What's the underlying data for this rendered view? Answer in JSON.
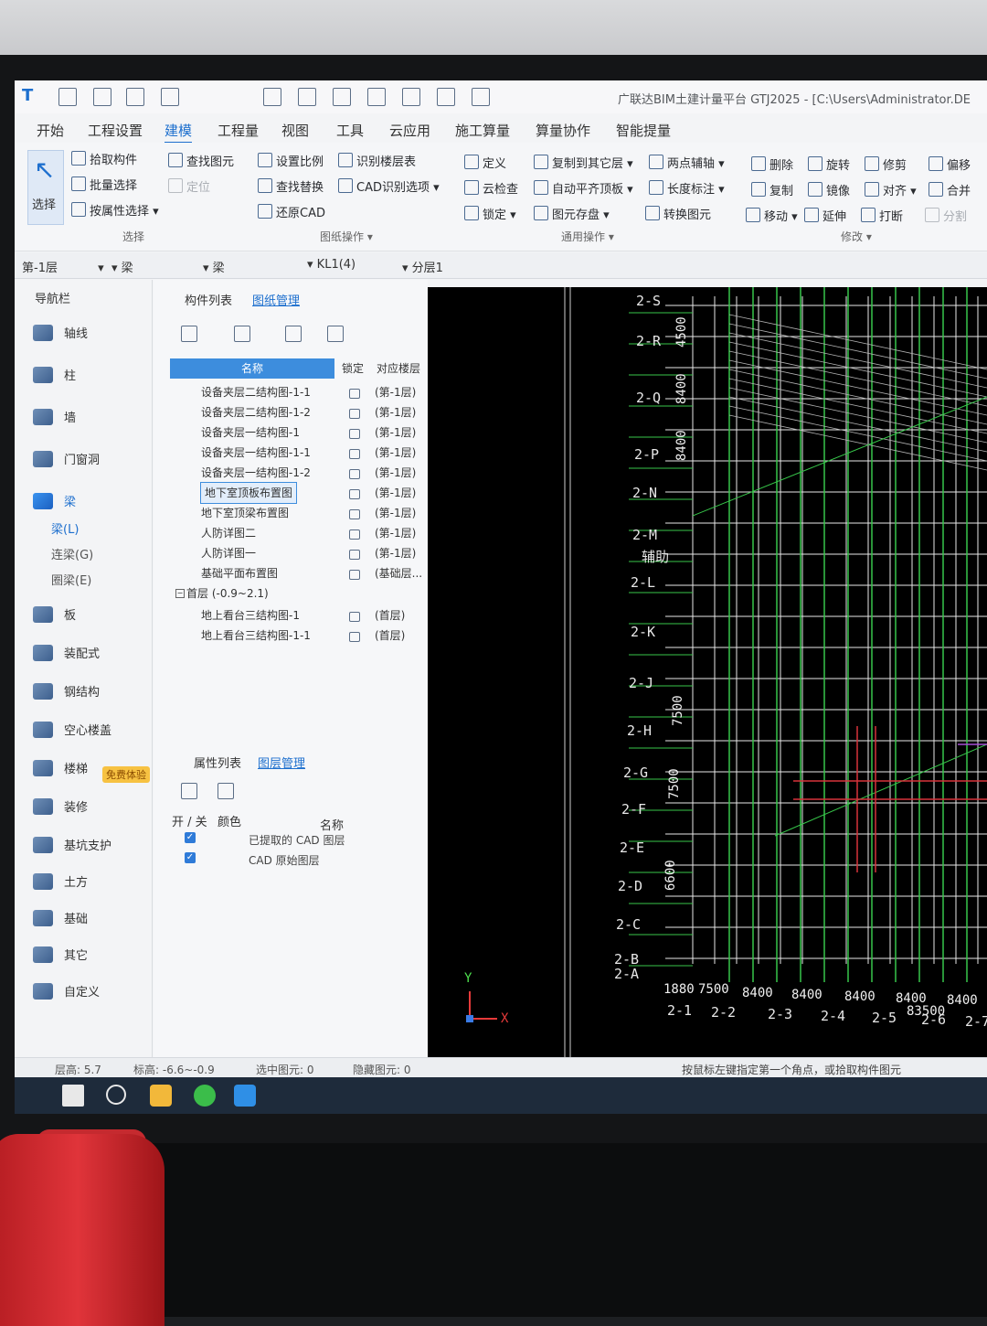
{
  "window": {
    "title": "广联达BIM土建计量平台 GTJ2025 - [C:\\Users\\Administrator.DE"
  },
  "menu": [
    "开始",
    "工程设置",
    "建模",
    "工程量",
    "视图",
    "工具",
    "云应用",
    "施工算量",
    "算量协作",
    "智能提量"
  ],
  "menu_active": "建模",
  "ribbon": {
    "select": {
      "label": "选择",
      "items": [
        "拾取构件",
        "批量选择",
        "按属性选择"
      ],
      "group": "选择"
    },
    "drawing": {
      "items": [
        "查找图元",
        "设置比例",
        "识别楼层表",
        "还原CAD",
        "查找替换",
        "CAD识别选项",
        "还原CAD"
      ],
      "disabled": "定位",
      "group": "图纸操作"
    },
    "common": {
      "items": [
        "定义",
        "复制到其它层",
        "两点辅轴",
        "云检查",
        "自动平齐顶板",
        "长度标注",
        "锁定",
        "图元存盘",
        "转换图元"
      ],
      "group": "通用操作"
    },
    "modify": {
      "items": [
        "删除",
        "旋转",
        "修剪",
        "偏移",
        "复制",
        "镜像",
        "对齐",
        "合并",
        "移动",
        "延伸",
        "打断",
        "分割"
      ],
      "group": "修改"
    }
  },
  "combos": [
    "第-1层",
    "梁",
    "梁",
    "KL1(4)",
    "分层1"
  ],
  "navigator": {
    "title": "导航栏",
    "items": [
      "轴线",
      "柱",
      "墙",
      "门窗洞",
      "梁",
      "板",
      "装配式",
      "钢结构",
      "空心楼盖",
      "楼梯",
      "装修",
      "基坑支护",
      "土方",
      "基础",
      "其它",
      "自定义"
    ],
    "selected": "梁",
    "sub_items": [
      "梁(L)",
      "连梁(G)",
      "圈梁(E)"
    ],
    "badge": "免费体验"
  },
  "component_panel": {
    "tabs": [
      "构件列表",
      "图纸管理"
    ],
    "columns": [
      "名称",
      "锁定",
      "对应楼层"
    ],
    "rows": [
      {
        "name": "设备夹层二结构图-1-1",
        "floor": "(第-1层)"
      },
      {
        "name": "设备夹层二结构图-1-2",
        "floor": "(第-1层)"
      },
      {
        "name": "设备夹层一结构图-1",
        "floor": "(第-1层)"
      },
      {
        "name": "设备夹层一结构图-1-1",
        "floor": "(第-1层)"
      },
      {
        "name": "设备夹层一结构图-1-2",
        "floor": "(第-1层)"
      },
      {
        "name": "地下室顶板布置图",
        "floor": "(第-1层)"
      },
      {
        "name": "地下室顶梁布置图",
        "floor": "(第-1层)"
      },
      {
        "name": "人防详图二",
        "floor": "(第-1层)"
      },
      {
        "name": "人防详图一",
        "floor": "(第-1层)"
      },
      {
        "name": "基础平面布置图",
        "floor": "(基础层..."
      }
    ],
    "group": "首层 (-0.9~2.1)",
    "group_rows": [
      {
        "name": "地上看台三结构图-1",
        "floor": "(首层)"
      },
      {
        "name": "地上看台三结构图-1-1",
        "floor": "(首层)"
      }
    ],
    "selected_row": "地下室顶板布置图"
  },
  "layer_panel": {
    "tabs": [
      "属性列表",
      "图层管理"
    ],
    "columns": [
      "开 / 关",
      "颜色",
      "名称"
    ],
    "rows": [
      "已提取的 CAD 图层",
      "CAD 原始图层"
    ]
  },
  "status": {
    "floor_height": "层高: 5.7",
    "elevation": "标高: -6.6~-0.9",
    "selected": "选中图元: 0",
    "hidden": "隐藏图元: 0",
    "hint": "按鼠标左键指定第一个角点，或拾取构件图元"
  },
  "canvas": {
    "axis_labels": [
      "2-S",
      "2-R",
      "2-Q",
      "2-P",
      "2-N",
      "2-M",
      "辅助",
      "2-L",
      "2-K",
      "2-J",
      "2-H",
      "2-G",
      "2-F",
      "2-E",
      "2-D",
      "2-C",
      "2-B",
      "2-A"
    ],
    "bottom_dims": [
      "1880",
      "7500",
      "8400",
      "8400",
      "8400",
      "8400",
      "83500",
      "8400"
    ],
    "bottom_axes": [
      "2-1",
      "2-2",
      "2-3",
      "2-4",
      "2-5",
      "2-6",
      "2-7"
    ],
    "vert_dims": [
      "4500",
      "8400",
      "8400",
      "7500",
      "7500",
      "6600"
    ],
    "ucs_x": "X",
    "ucs_y": "Y"
  }
}
